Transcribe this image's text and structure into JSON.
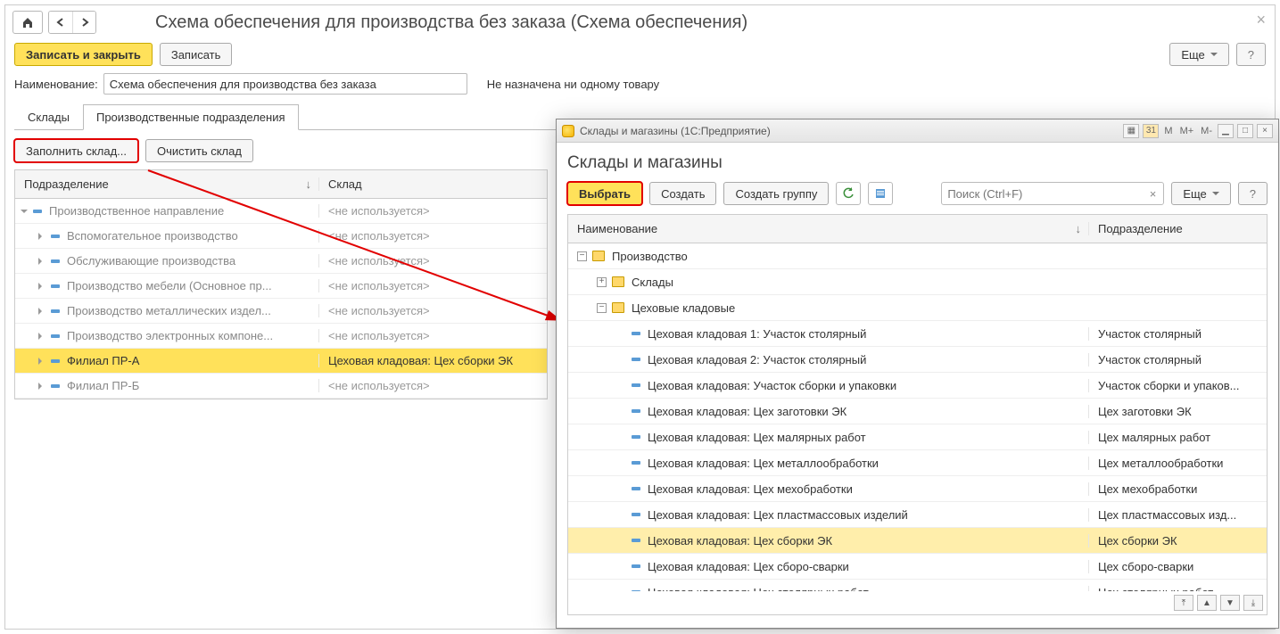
{
  "window": {
    "title": "Схема обеспечения для производства без заказа (Схема обеспечения)"
  },
  "toolbar": {
    "save_close": "Записать и закрыть",
    "save": "Записать",
    "more": "Еще",
    "help": "?"
  },
  "field": {
    "name_label": "Наименование:",
    "name_value": "Схема обеспечения для производства без заказа",
    "assigned_note": "Не назначена ни одному товару"
  },
  "tabs": {
    "warehouses": "Склады",
    "departments": "Производственные подразделения"
  },
  "tab_toolbar": {
    "fill": "Заполнить склад...",
    "clear": "Очистить склад"
  },
  "tree": {
    "col_dept": "Подразделение",
    "col_wh": "Склад",
    "rows": [
      {
        "level": 0,
        "open": true,
        "label": "Производственное направление",
        "wh": "<не используется>"
      },
      {
        "level": 1,
        "open": false,
        "label": "Вспомогательное производство",
        "wh": "<не используется>"
      },
      {
        "level": 1,
        "open": false,
        "label": "Обслуживающие производства",
        "wh": "<не используется>"
      },
      {
        "level": 1,
        "open": false,
        "label": "Производство мебели (Основное пр...",
        "wh": "<не используется>"
      },
      {
        "level": 1,
        "open": false,
        "label": "Производство металлических издел...",
        "wh": "<не используется>"
      },
      {
        "level": 1,
        "open": false,
        "label": "Производство электронных компоне...",
        "wh": "<не используется>"
      },
      {
        "level": 1,
        "open": false,
        "label": "Филиал ПР-А",
        "wh": "Цеховая кладовая: Цех сборки ЭК",
        "selected": true
      },
      {
        "level": 1,
        "open": false,
        "label": "Филиал ПР-Б",
        "wh": "<не используется>"
      }
    ]
  },
  "popup": {
    "window_title": "Склады и магазины  (1С:Предприятие)",
    "mem_labels": [
      "M",
      "M+",
      "M-"
    ],
    "heading": "Склады и магазины",
    "select": "Выбрать",
    "create": "Создать",
    "create_group": "Создать группу",
    "more": "Еще",
    "help": "?",
    "search_placeholder": "Поиск (Ctrl+F)",
    "col_name": "Наименование",
    "col_dept": "Подразделение",
    "rows": [
      {
        "type": "folder",
        "pm": "minus",
        "indent": 0,
        "name": "Производство",
        "dept": ""
      },
      {
        "type": "folder",
        "pm": "plus",
        "indent": 1,
        "name": "Склады",
        "dept": ""
      },
      {
        "type": "folder",
        "pm": "minus",
        "indent": 1,
        "name": "Цеховые кладовые",
        "dept": ""
      },
      {
        "type": "item",
        "indent": 2,
        "name": "Цеховая кладовая 1: Участок столярный",
        "dept": "Участок столярный"
      },
      {
        "type": "item",
        "indent": 2,
        "name": "Цеховая кладовая 2: Участок столярный",
        "dept": "Участок столярный"
      },
      {
        "type": "item",
        "indent": 2,
        "name": "Цеховая кладовая: Участок сборки и упаковки",
        "dept": "Участок сборки и упаков..."
      },
      {
        "type": "item",
        "indent": 2,
        "name": "Цеховая кладовая: Цех заготовки ЭК",
        "dept": "Цех заготовки ЭК"
      },
      {
        "type": "item",
        "indent": 2,
        "name": "Цеховая кладовая: Цех малярных работ",
        "dept": "Цех малярных работ"
      },
      {
        "type": "item",
        "indent": 2,
        "name": "Цеховая кладовая: Цех металлообработки",
        "dept": "Цех металлообработки"
      },
      {
        "type": "item",
        "indent": 2,
        "name": "Цеховая кладовая: Цех мехобработки",
        "dept": "Цех мехобработки"
      },
      {
        "type": "item",
        "indent": 2,
        "name": "Цеховая кладовая: Цех пластмассовых изделий",
        "dept": "Цех пластмассовых изд..."
      },
      {
        "type": "item",
        "indent": 2,
        "name": "Цеховая кладовая: Цех сборки ЭК",
        "dept": "Цех сборки ЭК",
        "selected": true
      },
      {
        "type": "item",
        "indent": 2,
        "name": "Цеховая кладовая: Цех сборо-сварки",
        "dept": "Цех сборо-сварки"
      },
      {
        "type": "item",
        "indent": 2,
        "name": "Цеховая кладовая: Цех столярных работ",
        "dept": "Цех столярных работ"
      }
    ]
  }
}
